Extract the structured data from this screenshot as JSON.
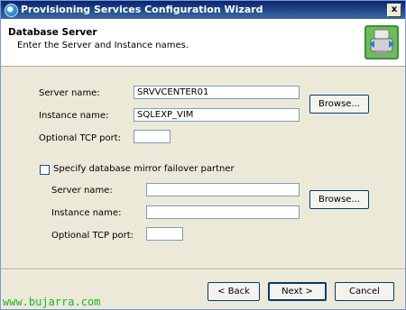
{
  "window": {
    "title": "Provisioning Services Configuration Wizard",
    "close_glyph": "x"
  },
  "header": {
    "title": "Database Server",
    "subtitle": "Enter the Server and Instance names."
  },
  "primary": {
    "server_label": "Server name:",
    "server_value": "SRVVCENTER01",
    "instance_label": "Instance name:",
    "instance_value": "SQLEXP_VIM",
    "port_label": "Optional TCP port:",
    "port_value": "",
    "browse_label": "Browse..."
  },
  "mirror": {
    "checkbox_label": "Specify database mirror failover partner",
    "checked": false,
    "server_label": "Server name:",
    "server_value": "",
    "instance_label": "Instance name:",
    "instance_value": "",
    "port_label": "Optional TCP port:",
    "port_value": "",
    "browse_label": "Browse..."
  },
  "footer": {
    "back_label": "< Back",
    "next_label": "Next >",
    "cancel_label": "Cancel"
  },
  "watermark": "www.bujarra.com"
}
